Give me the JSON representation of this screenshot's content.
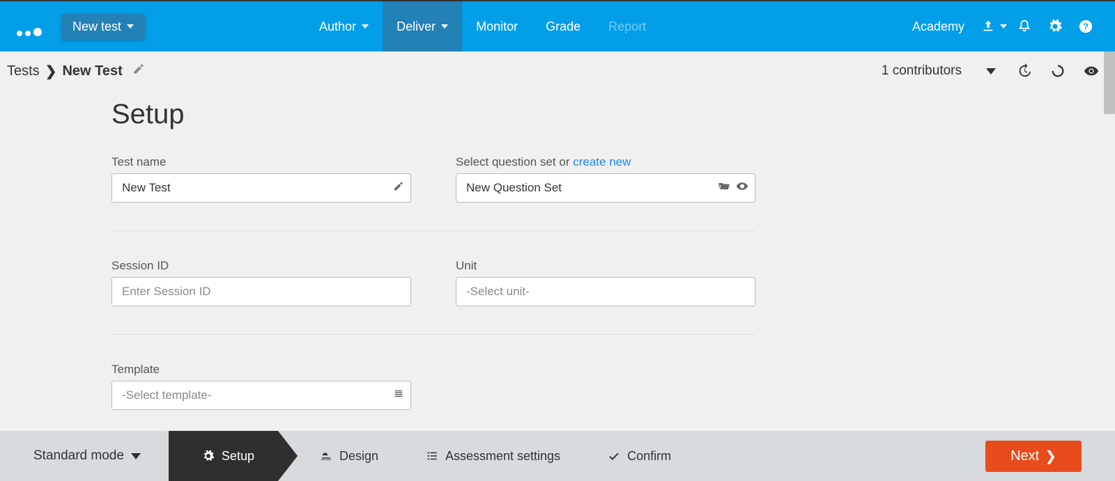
{
  "topnav": {
    "new_test_label": "New test",
    "items": {
      "author": "Author",
      "deliver": "Deliver",
      "monitor": "Monitor",
      "grade": "Grade",
      "report": "Report"
    },
    "academy": "Academy"
  },
  "breadcrumb": {
    "root": "Tests",
    "current": "New Test"
  },
  "subhead": {
    "contributors": "1 contributors"
  },
  "page": {
    "title": "Setup"
  },
  "form": {
    "test_name": {
      "label": "Test name",
      "value": "New Test"
    },
    "question_set": {
      "label_prefix": "Select question set or ",
      "create_new": "create new",
      "value": "New Question Set"
    },
    "session_id": {
      "label": "Session ID",
      "placeholder": "Enter Session ID"
    },
    "unit": {
      "label": "Unit",
      "placeholder": "-Select unit-"
    },
    "template": {
      "label": "Template",
      "placeholder": "-Select template-"
    }
  },
  "footer": {
    "mode": "Standard mode",
    "steps": {
      "setup": "Setup",
      "design": "Design",
      "assessment": "Assessment settings",
      "confirm": "Confirm"
    },
    "next": "Next"
  }
}
